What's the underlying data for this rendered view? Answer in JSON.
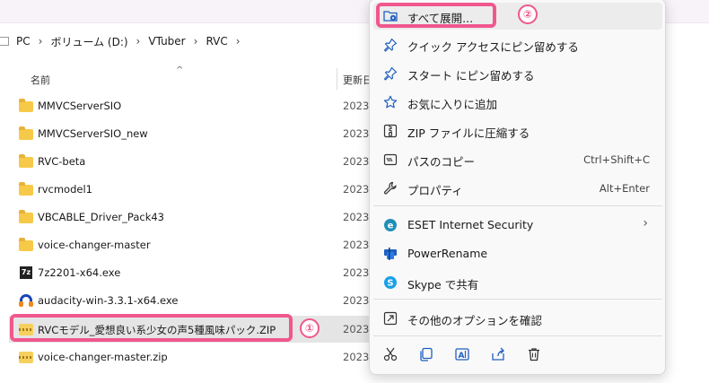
{
  "breadcrumb": [
    "PC",
    "ボリューム (D:)",
    "VTuber",
    "RVC"
  ],
  "columns": {
    "name": "名前",
    "date": "更新日"
  },
  "files": [
    {
      "name": "MMVCServerSIO",
      "date": "2023/",
      "type": "folder"
    },
    {
      "name": "MMVCServerSIO_new",
      "date": "2023/",
      "type": "folder"
    },
    {
      "name": "RVC-beta",
      "date": "2023/",
      "type": "folder"
    },
    {
      "name": "rvcmodel1",
      "date": "2023/",
      "type": "folder"
    },
    {
      "name": "VBCABLE_Driver_Pack43",
      "date": "2023/",
      "type": "folder"
    },
    {
      "name": "voice-changer-master",
      "date": "2023/",
      "type": "folder"
    },
    {
      "name": "7z2201-x64.exe",
      "date": "2023/",
      "type": "exe-7z"
    },
    {
      "name": "audacity-win-3.3.1-x64.exe",
      "date": "2023/",
      "type": "exe-audacity"
    },
    {
      "name": "RVCモデル_愛想良い系少女の声5種風味パック.ZIP",
      "date": "2023/",
      "type": "zip",
      "selected": true
    },
    {
      "name": "voice-changer-master.zip",
      "date": "2023/",
      "type": "zip"
    }
  ],
  "annotations": {
    "one": "①",
    "two": "②"
  },
  "context_menu": {
    "items": [
      {
        "label": "すべて展開...",
        "icon": "extract-all-icon"
      },
      {
        "label": "クイック アクセスにピン留めする",
        "icon": "pin-icon"
      },
      {
        "label": "スタート にピン留めする",
        "icon": "pin-icon"
      },
      {
        "label": "お気に入りに追加",
        "icon": "star-icon"
      },
      {
        "label": "ZIP ファイルに圧縮する",
        "icon": "zip-icon"
      },
      {
        "label": "パスのコピー",
        "icon": "copy-path-icon",
        "shortcut": "Ctrl+Shift+C"
      },
      {
        "label": "プロパティ",
        "icon": "wrench-icon",
        "shortcut": "Alt+Enter"
      },
      {
        "label": "ESET Internet Security",
        "icon": "eset-icon",
        "submenu": true
      },
      {
        "label": "PowerRename",
        "icon": "powerrename-icon"
      },
      {
        "label": "Skype で共有",
        "icon": "skype-icon"
      },
      {
        "label": "その他のオプションを確認",
        "icon": "more-options-icon"
      }
    ],
    "bottom_actions": [
      "cut-icon",
      "copy-icon",
      "rename-icon",
      "share-icon",
      "delete-icon"
    ]
  },
  "colors": {
    "accent": "#f0578d",
    "folder": "#f7c948",
    "menu_icon": "#1f5fbf"
  }
}
